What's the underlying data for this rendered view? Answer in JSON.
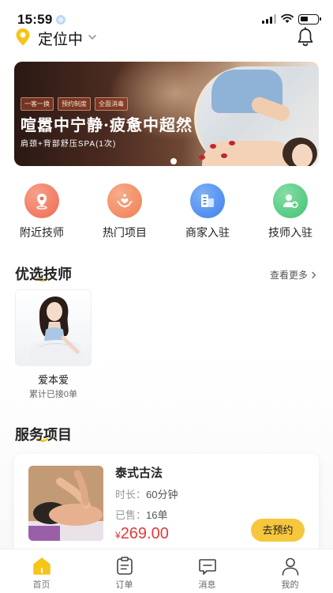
{
  "status_bar": {
    "time": "15:59"
  },
  "header": {
    "location_label": "定位中"
  },
  "banner": {
    "tags": [
      "一客一换",
      "预约制度",
      "全面消毒"
    ],
    "title": "喧嚣中宁静·疲惫中超然",
    "subtitle": "肩颈+背部舒压SPA(1次)"
  },
  "quick_nav": [
    {
      "label": "附近技师",
      "icon": "location-pin-icon",
      "color": "#f0765a"
    },
    {
      "label": "热门项目",
      "icon": "hands-heart-icon",
      "color": "#f0885e"
    },
    {
      "label": "商家入驻",
      "icon": "store-icon",
      "color": "#4e8ff0"
    },
    {
      "label": "技师入驻",
      "icon": "user-add-icon",
      "color": "#4fcb7f"
    }
  ],
  "featured": {
    "title": "优选技师",
    "more_label": "查看更多",
    "technician": {
      "name": "爱本爱",
      "orders": "累计已接0单"
    }
  },
  "services": {
    "title": "服务项目",
    "item": {
      "name": "泰式古法",
      "duration_label": "时长：",
      "duration": "60分钟",
      "sold_label": "已售：",
      "sold": "16单",
      "currency": "¥",
      "price": "269.00",
      "button": "去预约"
    }
  },
  "tabbar": [
    {
      "label": "首页",
      "icon": "home-icon",
      "active": true
    },
    {
      "label": "订单",
      "icon": "order-icon",
      "active": false
    },
    {
      "label": "消息",
      "icon": "message-icon",
      "active": false
    },
    {
      "label": "我的",
      "icon": "profile-icon",
      "active": false
    }
  ],
  "colors": {
    "accent": "#f6c73c",
    "price": "#e03a3a"
  }
}
